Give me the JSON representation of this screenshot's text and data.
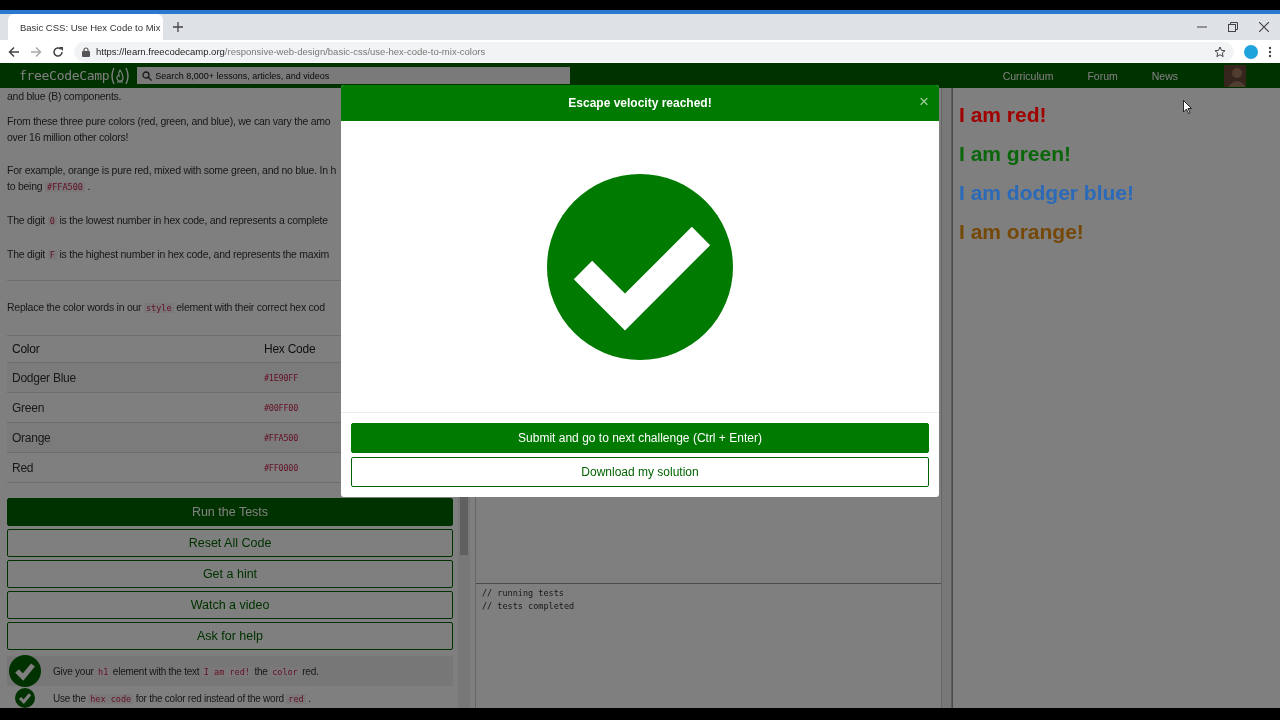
{
  "browser": {
    "tab": {
      "title": "Basic CSS: Use Hex Code to Mix"
    },
    "url": {
      "host": "https://learn.freecodecamp.org",
      "path": "/responsive-web-design/basic-css/use-hex-code-to-mix-colors"
    }
  },
  "site_nav": {
    "logo": "freeCodeCamp",
    "search": {
      "placeholder": "Search 8,000+ lessons, articles, and videos"
    },
    "links": [
      "Curriculum",
      "Forum",
      "News"
    ]
  },
  "lesson": {
    "paragraphs": [
      {
        "lines": [
          [
            {
              "text": "and blue (B) components.",
              "code": false
            }
          ]
        ]
      },
      {
        "lines": [
          [
            {
              "text": "From these three pure colors (red, green, and blue), we can vary the amo",
              "code": false
            }
          ],
          [
            {
              "text": "over 16 million other colors!",
              "code": false
            }
          ]
        ]
      },
      {
        "lines": [
          [
            {
              "text": "For example, orange is pure red, mixed with some green, and no blue. In h",
              "code": false
            }
          ],
          [
            {
              "text": "to being ",
              "code": false
            },
            {
              "text": "#FFA500",
              "code": true
            },
            {
              "text": " .",
              "code": false
            }
          ]
        ]
      },
      {
        "lines": [
          [
            {
              "text": "The digit ",
              "code": false
            },
            {
              "text": "0",
              "code": true
            },
            {
              "text": " is the lowest number in hex code, and represents a complete",
              "code": false
            }
          ]
        ]
      },
      {
        "lines": [
          [
            {
              "text": "The digit ",
              "code": false
            },
            {
              "text": "F",
              "code": true
            },
            {
              "text": " is the highest number in hex code, and represents the maxim",
              "code": false
            }
          ]
        ]
      },
      {
        "lines": [
          [
            {
              "text": "Replace the color words in our ",
              "code": false
            },
            {
              "text": "style",
              "code": true
            },
            {
              "text": " element with their correct hex cod",
              "code": false
            }
          ]
        ]
      }
    ],
    "table": {
      "columns": [
        "Color",
        "Hex Code"
      ],
      "rows": [
        [
          "Dodger Blue",
          "#1E90FF"
        ],
        [
          "Green",
          "#00FF00"
        ],
        [
          "Orange",
          "#FFA500"
        ],
        [
          "Red",
          "#FF0000"
        ]
      ]
    },
    "buttons": [
      {
        "label": "Run the Tests",
        "kind": "primary"
      },
      {
        "label": "Reset All Code",
        "kind": "outline"
      },
      {
        "label": "Get a hint",
        "kind": "outline"
      },
      {
        "label": "Watch a video",
        "kind": "outline"
      },
      {
        "label": "Ask for help",
        "kind": "outline"
      }
    ],
    "tests": [
      {
        "passed": true,
        "segments": [
          {
            "text": "Give your ",
            "code": false
          },
          {
            "text": "h1",
            "code": true
          },
          {
            "text": " element with the text ",
            "code": false
          },
          {
            "text": "I am red!",
            "code": true
          },
          {
            "text": " the ",
            "code": false
          },
          {
            "text": "color",
            "code": true
          },
          {
            "text": " red.",
            "code": false
          }
        ]
      },
      {
        "passed": true,
        "segments": [
          {
            "text": "Use the ",
            "code": false
          },
          {
            "text": "hex code",
            "code": true
          },
          {
            "text": " for the color red instead of the word ",
            "code": false
          },
          {
            "text": "red",
            "code": true
          },
          {
            "text": " .",
            "code": false
          }
        ]
      }
    ]
  },
  "console": {
    "lines": [
      "// running tests",
      "// tests completed"
    ]
  },
  "preview": {
    "headings": [
      {
        "text": "I am red!",
        "color": "#a00000"
      },
      {
        "text": "I am green!",
        "color": "#0a660a"
      },
      {
        "text": "I am dodger blue!",
        "color": "#2a6ab8"
      },
      {
        "text": "I am orange!",
        "color": "#754808"
      }
    ]
  },
  "modal": {
    "title": "Escape velocity reached!",
    "close": "×",
    "buttons": [
      {
        "label": "Submit and go to next challenge (Ctrl + Enter)",
        "kind": "primary"
      },
      {
        "label": "Download my solution",
        "kind": "outline"
      }
    ]
  }
}
